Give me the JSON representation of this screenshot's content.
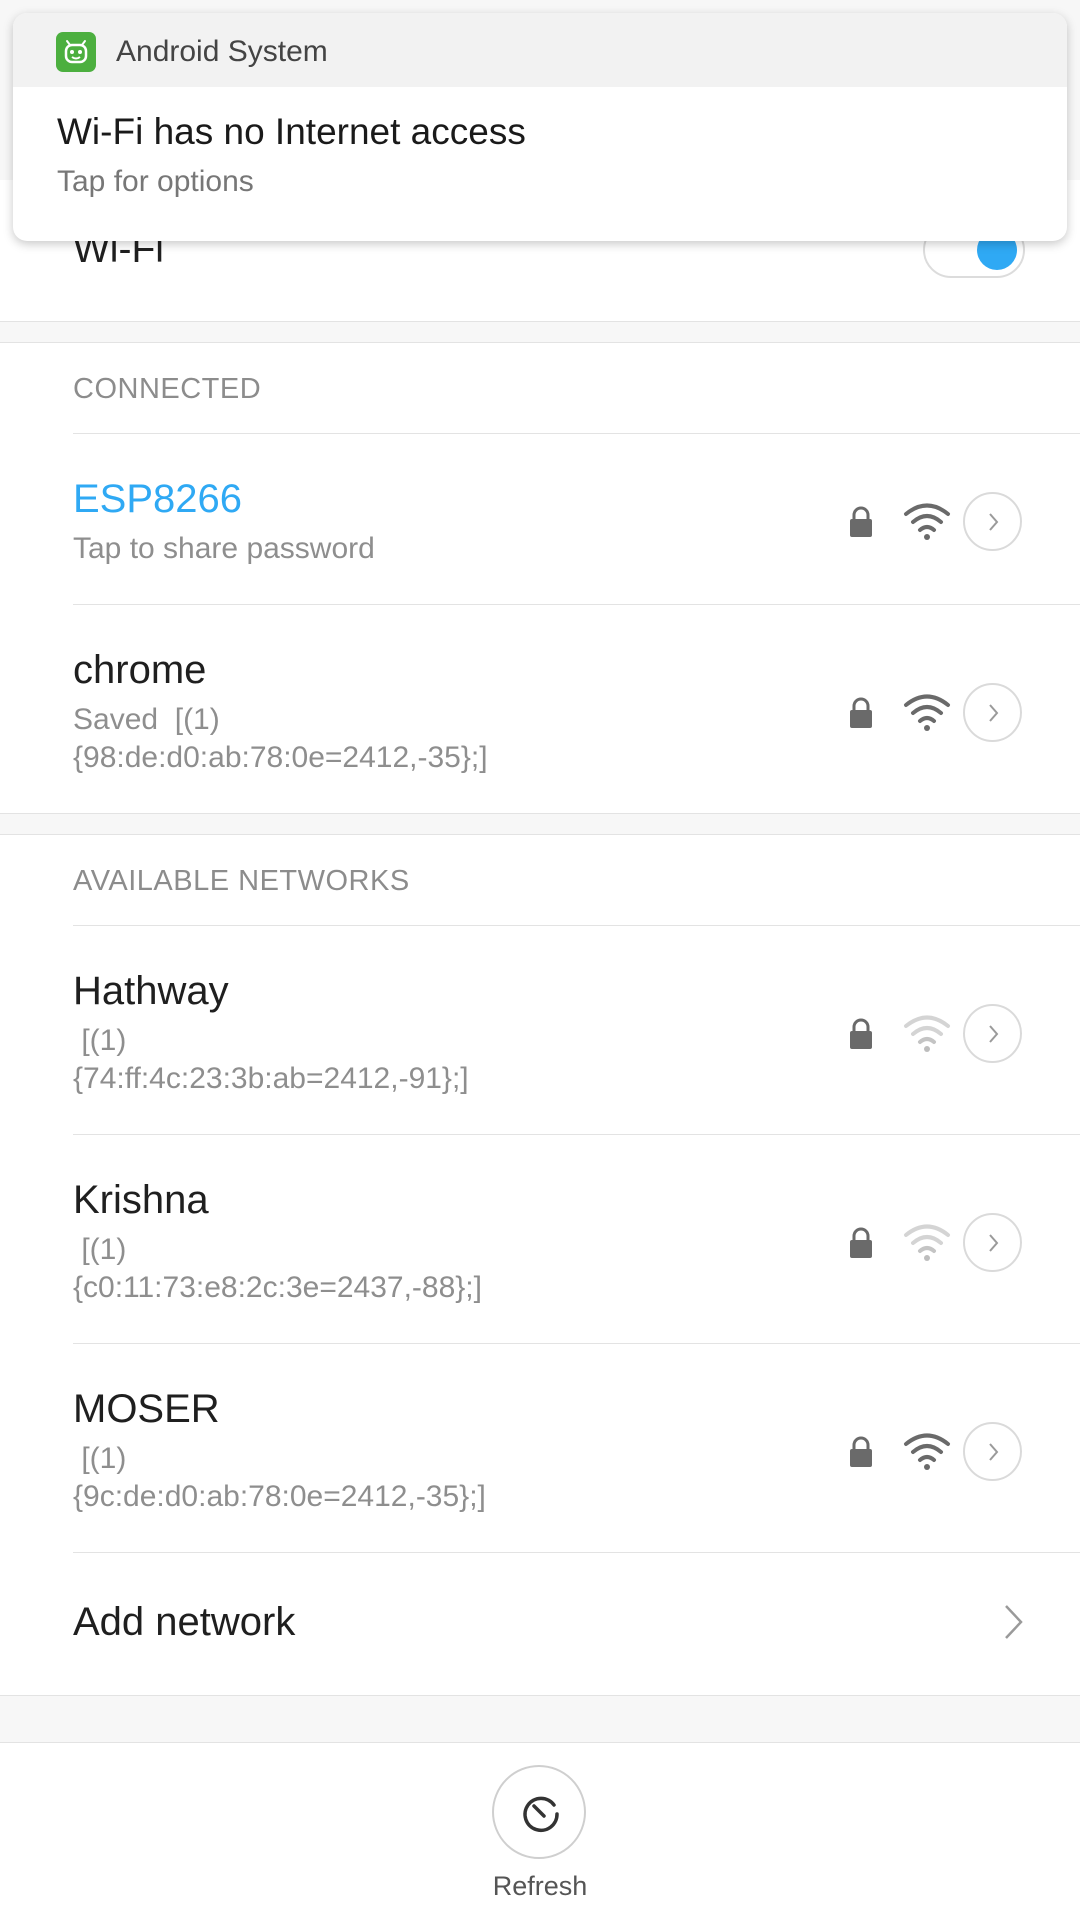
{
  "notification": {
    "app_name": "Android System",
    "title": "Wi-Fi has no Internet access",
    "text": "Tap for options",
    "icon": "android-system-icon"
  },
  "wifi": {
    "label": "Wi-Fi",
    "enabled": true
  },
  "connected_section": {
    "header": "CONNECTED",
    "networks": [
      {
        "name": "ESP8266",
        "subtitle": "Tap to share password",
        "secured": true,
        "signal_level": "strong",
        "status": "connected"
      },
      {
        "name": "chrome",
        "subtitle": "Saved  [(1)\n{98:de:d0:ab:78:0e=2412,-35};]",
        "secured": true,
        "signal_level": "strong",
        "status": "saved"
      }
    ]
  },
  "available_section": {
    "header": "AVAILABLE NETWORKS",
    "networks": [
      {
        "name": "Hathway",
        "subtitle": " [(1)\n{74:ff:4c:23:3b:ab=2412,-91};]",
        "secured": true,
        "signal_level": "weak"
      },
      {
        "name": "Krishna",
        "subtitle": " [(1)\n{c0:11:73:e8:2c:3e=2437,-88};]",
        "secured": true,
        "signal_level": "weak"
      },
      {
        "name": "MOSER",
        "subtitle": " [(1)\n{9c:de:d0:ab:78:0e=2412,-35};]",
        "secured": true,
        "signal_level": "strong"
      }
    ]
  },
  "add_network": {
    "label": "Add network"
  },
  "bottom": {
    "refresh_label": "Refresh"
  },
  "colors": {
    "accent": "#2fa9f4",
    "app_icon": "#4caf3f",
    "signal_strong": "#6a6a6a",
    "signal_weak": "#cfcfcf"
  }
}
